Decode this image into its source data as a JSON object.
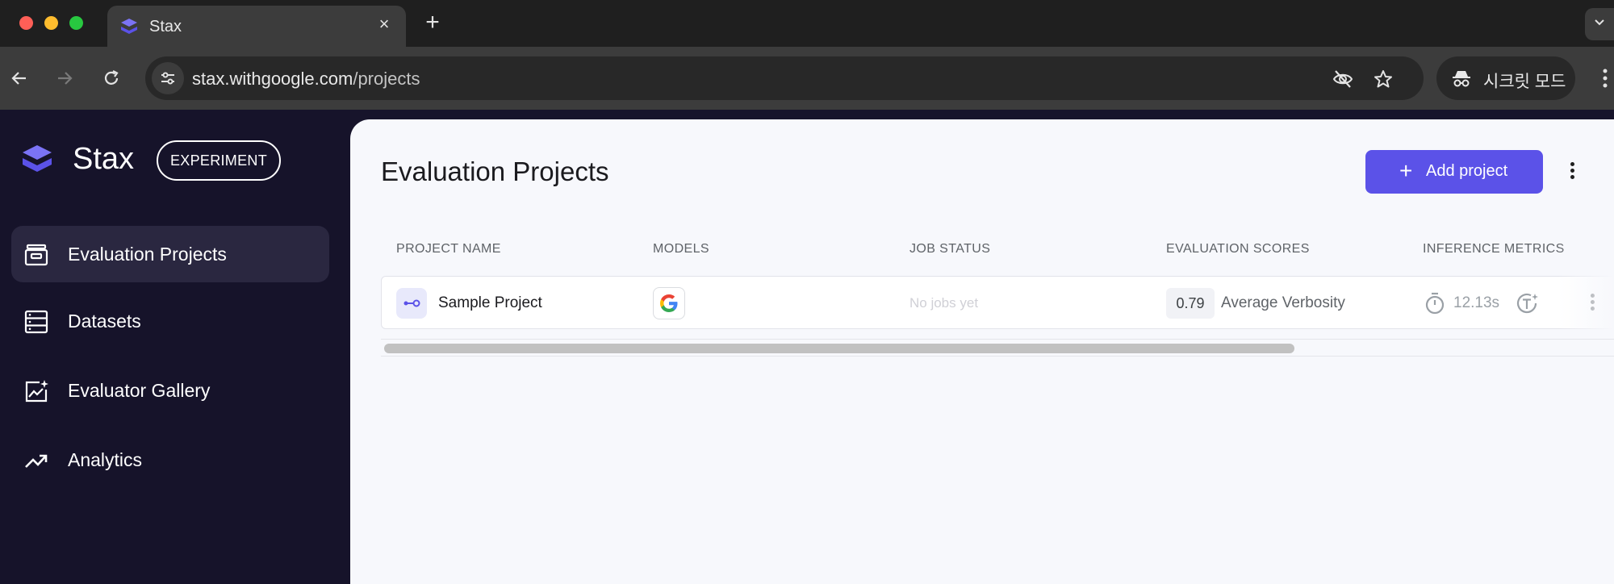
{
  "browser": {
    "tab_title": "Stax",
    "tab_close": "×",
    "new_tab": "+",
    "url_host": "stax.withgoogle.com",
    "url_path": "/projects",
    "incognito_label": "시크릿 모드"
  },
  "sidebar": {
    "brand": "Stax",
    "badge": "EXPERIMENT",
    "items": [
      {
        "label": "Evaluation Projects",
        "icon": "archive-box-icon",
        "active": true
      },
      {
        "label": "Datasets",
        "icon": "database-icon",
        "active": false
      },
      {
        "label": "Evaluator Gallery",
        "icon": "sparkle-chart-icon",
        "active": false
      },
      {
        "label": "Analytics",
        "icon": "trending-up-icon",
        "active": false
      }
    ]
  },
  "main": {
    "title": "Evaluation Projects",
    "add_button_label": "Add project",
    "add_button_plus": "+",
    "columns": [
      "PROJECT NAME",
      "MODELS",
      "JOB STATUS",
      "EVALUATION SCORES",
      "INFERENCE METRICS"
    ],
    "rows": [
      {
        "name": "Sample Project",
        "model_icon": "google-g-icon",
        "job_status": "No jobs yet",
        "score": "0.79",
        "score_label": "Average Verbosity",
        "latency": "12.13s"
      }
    ]
  },
  "colors": {
    "accent": "#5b52e8",
    "sidebar_bg": "#16132a",
    "main_bg": "#f7f8fc"
  }
}
